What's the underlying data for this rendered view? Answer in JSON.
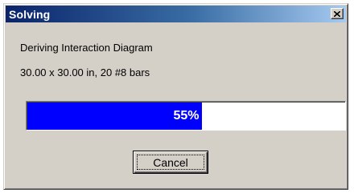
{
  "window": {
    "title": "Solving",
    "close_icon": "close-icon"
  },
  "status": {
    "line1": "Deriving Interaction Diagram",
    "line2": "30.00 x 30.00 in, 20 #8 bars"
  },
  "progress": {
    "percent": 55,
    "label": "55%",
    "fill_color": "#0000ff"
  },
  "buttons": {
    "cancel_label": "Cancel"
  }
}
